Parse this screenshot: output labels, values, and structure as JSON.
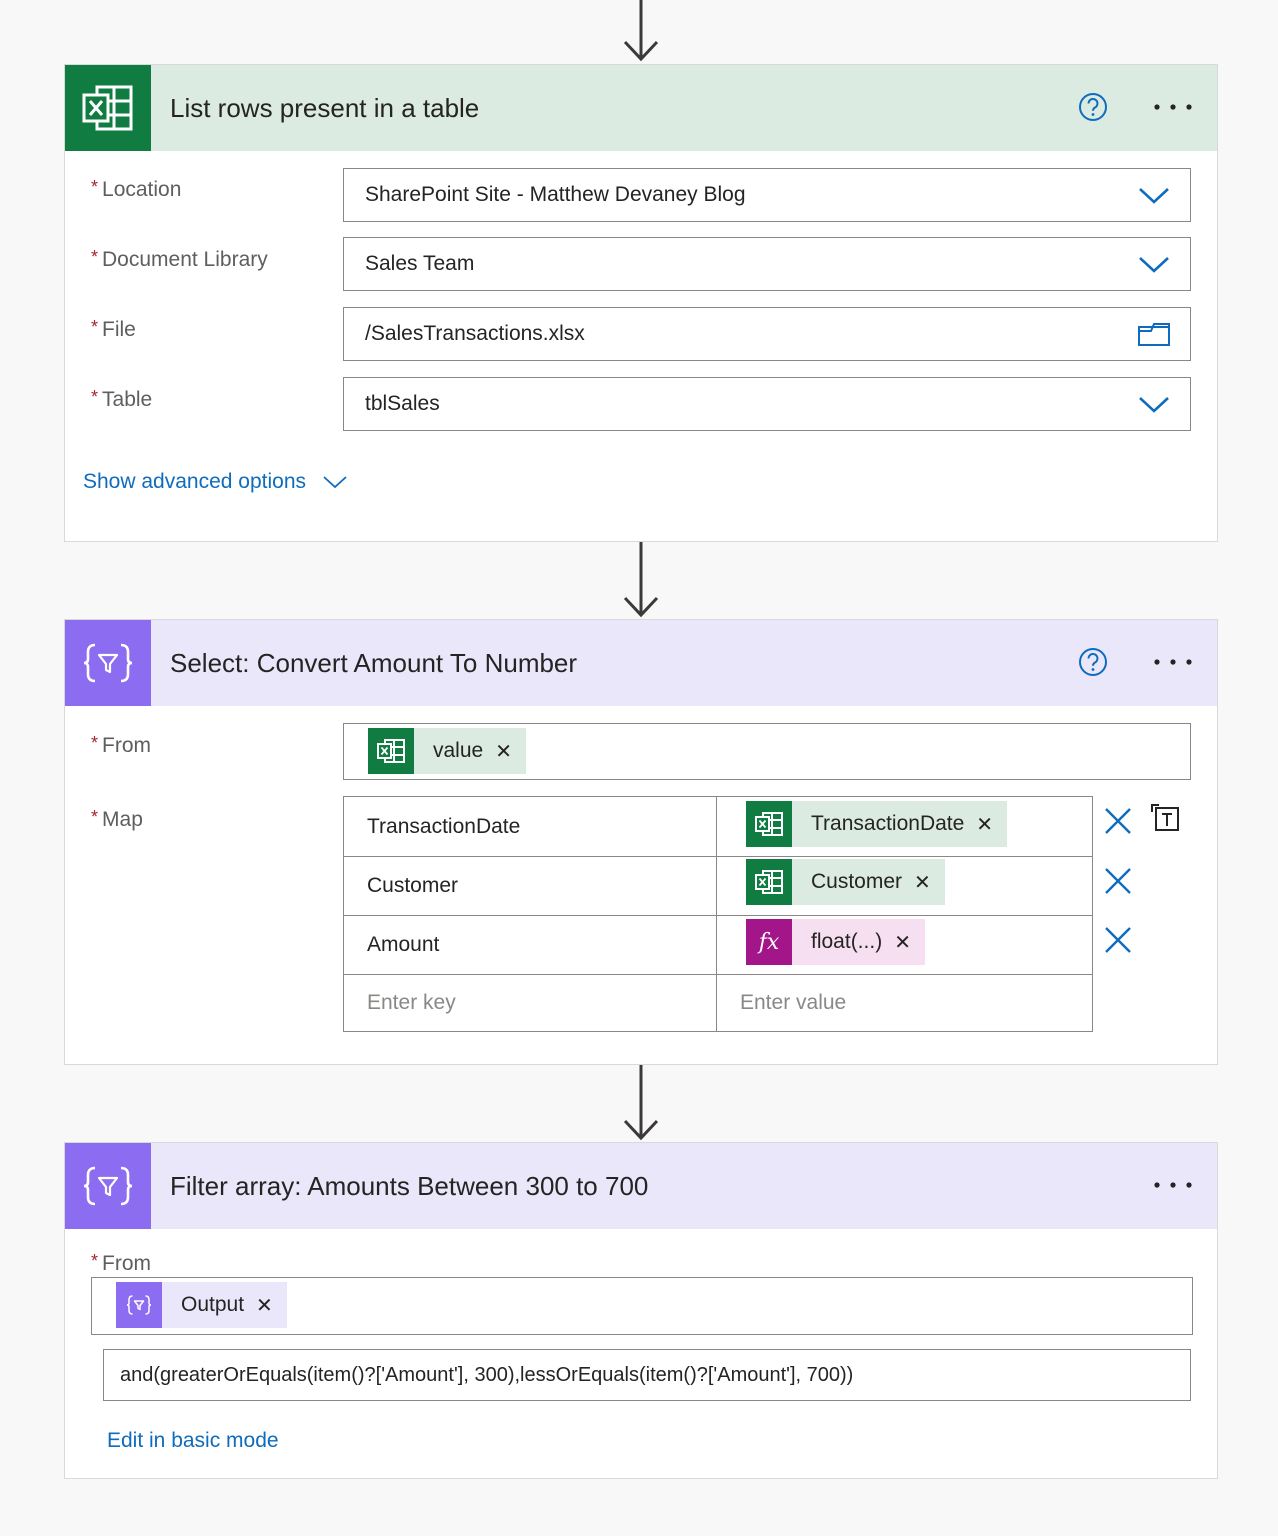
{
  "excel_step": {
    "title": "List rows present in a table",
    "icon": "excel-icon",
    "fields": {
      "location": {
        "label": "Location",
        "value": "SharePoint Site - Matthew Devaney Blog"
      },
      "document_library": {
        "label": "Document Library",
        "value": "Sales Team"
      },
      "file": {
        "label": "File",
        "value": "/SalesTransactions.xlsx"
      },
      "table": {
        "label": "Table",
        "value": "tblSales"
      }
    },
    "advanced_link": "Show advanced options"
  },
  "select_step": {
    "title": "Select: Convert Amount To Number",
    "icon": "data-operation-icon",
    "from": {
      "label": "From",
      "token": "value"
    },
    "map": {
      "label": "Map",
      "rows": [
        {
          "key": "TransactionDate",
          "value": "TransactionDate",
          "token_type": "excel"
        },
        {
          "key": "Customer",
          "value": "Customer",
          "token_type": "excel"
        },
        {
          "key": "Amount",
          "value": "float(...)",
          "token_type": "expression"
        }
      ],
      "key_placeholder": "Enter key",
      "value_placeholder": "Enter value"
    }
  },
  "filter_step": {
    "title": "Filter array: Amounts Between 300 to 700",
    "icon": "data-operation-icon",
    "from": {
      "label": "From",
      "token": "Output"
    },
    "expression": "and(greaterOrEquals(item()?['Amount'], 300),lessOrEquals(item()?['Amount'], 700))",
    "edit_link": "Edit in basic mode"
  },
  "required_mark": "*",
  "colors": {
    "excel_green": "#107c41",
    "excel_header": "#dcebe2",
    "data_op_purple": "#8c6cf0",
    "data_op_header": "#ebe7fb",
    "expression_magenta": "#a3168a",
    "link_blue": "#0f6cbd"
  }
}
